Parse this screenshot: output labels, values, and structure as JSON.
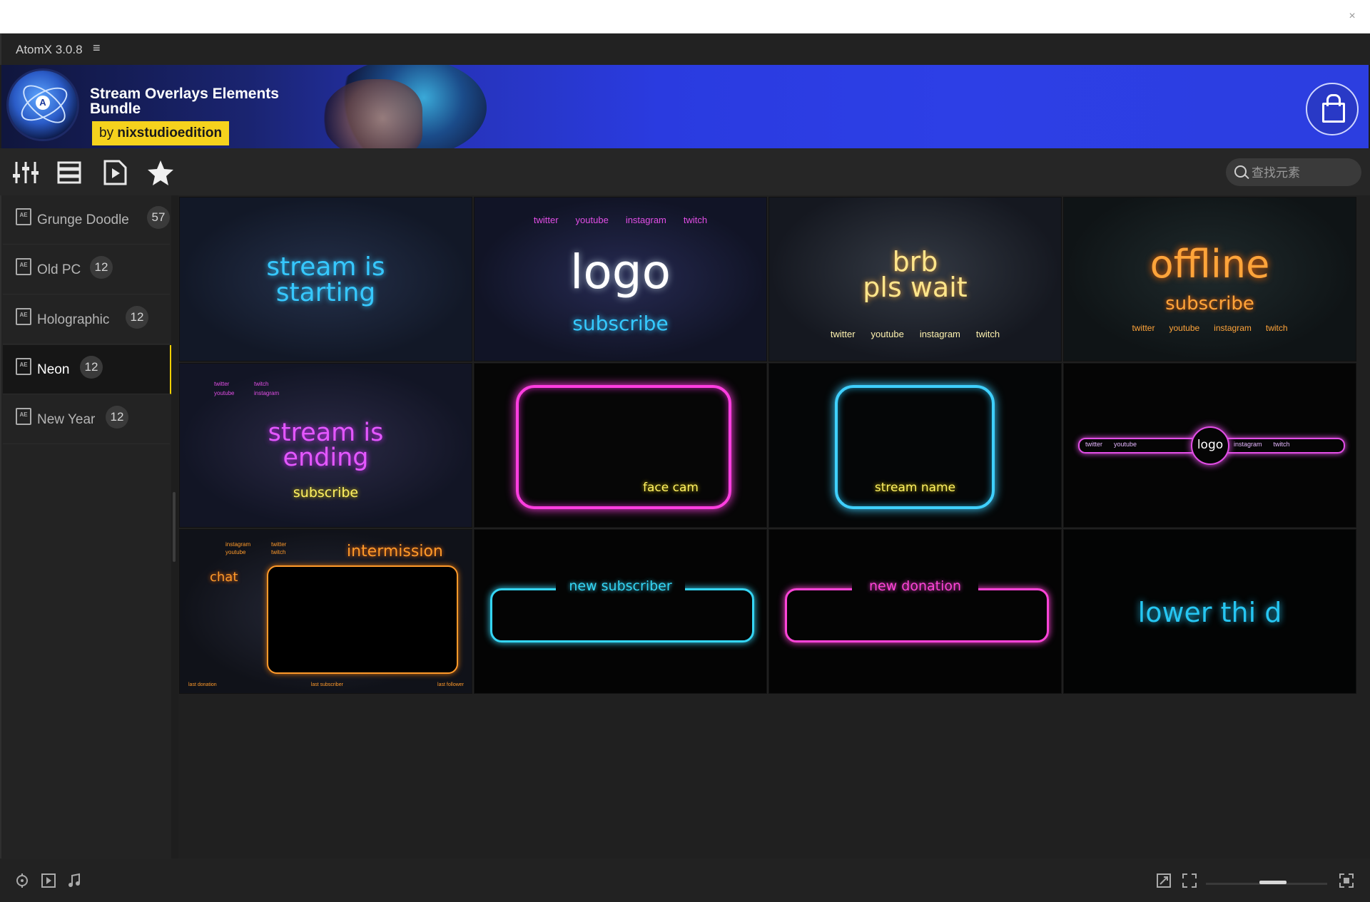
{
  "window": {
    "close_icon": "close-icon",
    "app_title": "AtomX 3.0.8",
    "menu_icon": "≡"
  },
  "banner": {
    "title": "Stream Overlays Elements Bundle",
    "author_prefix": "by",
    "author": "nixstudioedition"
  },
  "toolbar": {
    "icons": [
      "sliders-icon",
      "list-view-icon",
      "media-file-icon",
      "star-icon"
    ],
    "search_placeholder": "查找元素"
  },
  "sidebar": {
    "items": [
      {
        "label": "Grunge Doodle",
        "count": "57",
        "active": false
      },
      {
        "label": "Old PC",
        "count": "12",
        "active": false
      },
      {
        "label": "Holographic",
        "count": "12",
        "active": false
      },
      {
        "label": "Neon",
        "count": "12",
        "active": true
      },
      {
        "label": "New Year",
        "count": "12",
        "active": false
      }
    ]
  },
  "thumbnails": [
    {
      "lines": [
        "stream is",
        "starting"
      ],
      "color": "#36c8ff"
    },
    {
      "socials": [
        "twitter",
        "youtube",
        "instagram",
        "twitch"
      ],
      "main": "logo",
      "sub": "subscribe",
      "color": "#ffffff",
      "sub_color": "#35c9ff",
      "social_color": "#e24ee6"
    },
    {
      "lines": [
        "brb",
        "pls wait"
      ],
      "color": "#ffe58a",
      "socials": [
        "twitter",
        "youtube",
        "instagram",
        "twitch"
      ],
      "social_color": "#fff3b0"
    },
    {
      "main": "offline",
      "sub": "subscribe",
      "color": "#ffa43a",
      "socials": [
        "twitter",
        "youtube",
        "instagram",
        "twitch"
      ],
      "social_color": "#ffa43a"
    },
    {
      "socials": [
        "twitter",
        "twitch",
        "youtube",
        "instagram"
      ],
      "lines": [
        "stream is",
        "ending"
      ],
      "sub": "subscribe",
      "color": "#e457ff",
      "sub_color": "#fff263",
      "social_color": "#e24ee6"
    },
    {
      "label": "face cam",
      "color": "#ff3ee0",
      "label_color": "#fff263"
    },
    {
      "label": "stream name",
      "color": "#3fd0ff",
      "label_color": "#fff263"
    },
    {
      "socials": [
        "twitter",
        "youtube",
        "instagram",
        "twitch"
      ],
      "main": "logo",
      "color": "#e24ee6"
    },
    {
      "socials": [
        "instagram",
        "twitter",
        "youtube",
        "twitch"
      ],
      "title": "intermission",
      "chat": "chat",
      "color": "#ff9a2a",
      "social_color": "#ff9a2a",
      "footer": [
        "last donation",
        "last subscriber",
        "last follower"
      ]
    },
    {
      "label": "new subscriber",
      "color": "#35d6f5"
    },
    {
      "label": "new donation",
      "color": "#ff44d8"
    },
    {
      "label": "lower thi d",
      "color": "#26c6f2"
    }
  ],
  "bottombar": {
    "left_icons": [
      "snap-icon",
      "play-icon",
      "music-icon"
    ],
    "right_icons": [
      "expand-icon",
      "fit-icon",
      "fullscreen-icon"
    ],
    "zoom_fraction": 0.57
  }
}
